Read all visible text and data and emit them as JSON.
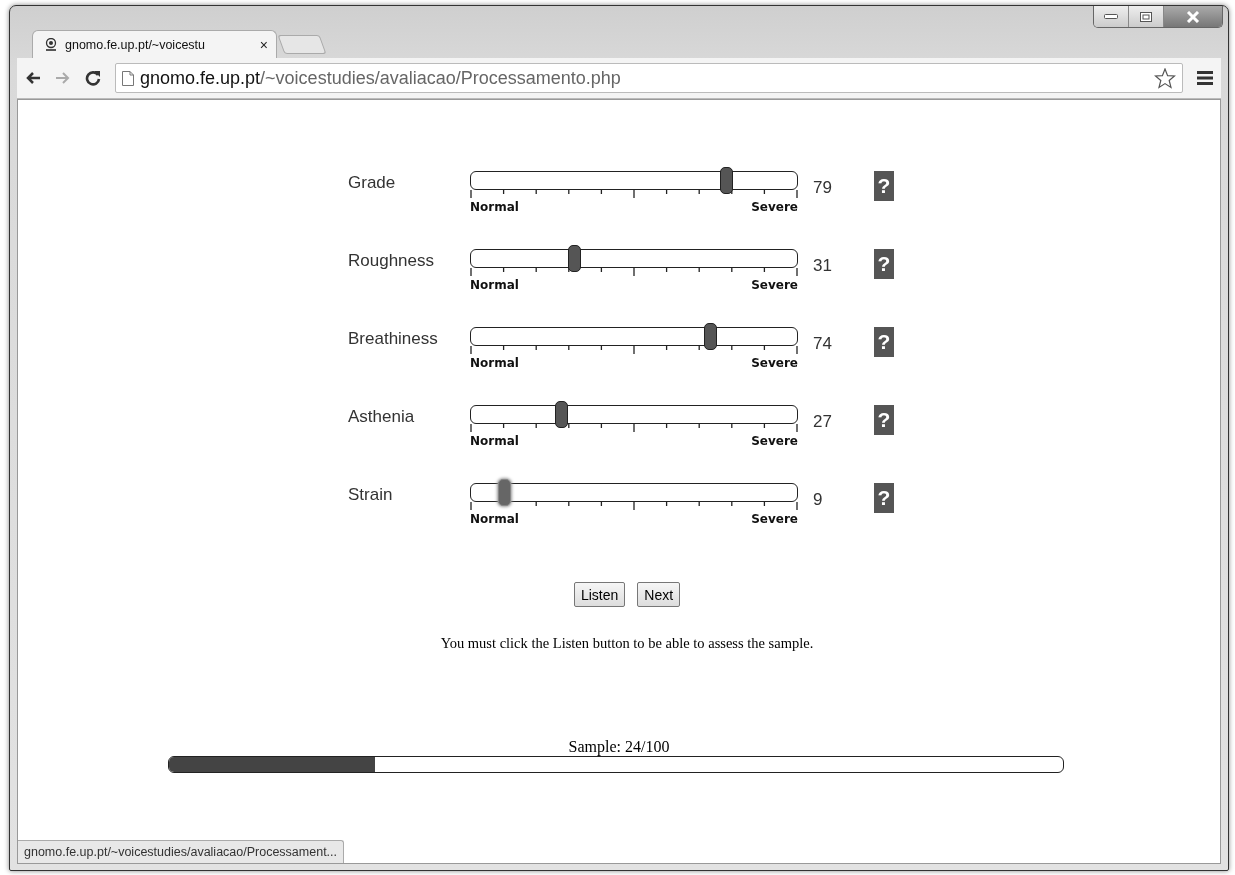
{
  "browser": {
    "tab_title": "gnomo.fe.up.pt/~voicestu",
    "tab_close": "×",
    "url_host": "gnomo.fe.up.pt",
    "url_path": "/~voicestudies/avaliacao/Processamento.php",
    "status_text": "gnomo.fe.up.pt/~voicestudies/avaliacao/Processament..."
  },
  "ratings": [
    {
      "label": "Grade",
      "level": 0.79,
      "value": "79",
      "min_label": "Normal",
      "max_label": "Severe",
      "help": "?",
      "focused": false
    },
    {
      "label": "Roughness",
      "level": 0.31,
      "value": "31",
      "min_label": "Normal",
      "max_label": "Severe",
      "help": "?",
      "focused": false
    },
    {
      "label": "Breathiness",
      "level": 0.74,
      "value": "74",
      "min_label": "Normal",
      "max_label": "Severe",
      "help": "?",
      "focused": false
    },
    {
      "label": "Asthenia",
      "level": 0.27,
      "value": "27",
      "min_label": "Normal",
      "max_label": "Severe",
      "help": "?",
      "focused": false
    },
    {
      "label": "Strain",
      "level": 0.09,
      "value": "9",
      "min_label": "Normal",
      "max_label": "Severe",
      "help": "?",
      "focused": true
    }
  ],
  "buttons": [
    "Listen",
    "Next"
  ],
  "message": "You must click the Listen button to be able to assess the sample.",
  "progress": {
    "label": "Sample: 24/100",
    "level": 0.23
  }
}
